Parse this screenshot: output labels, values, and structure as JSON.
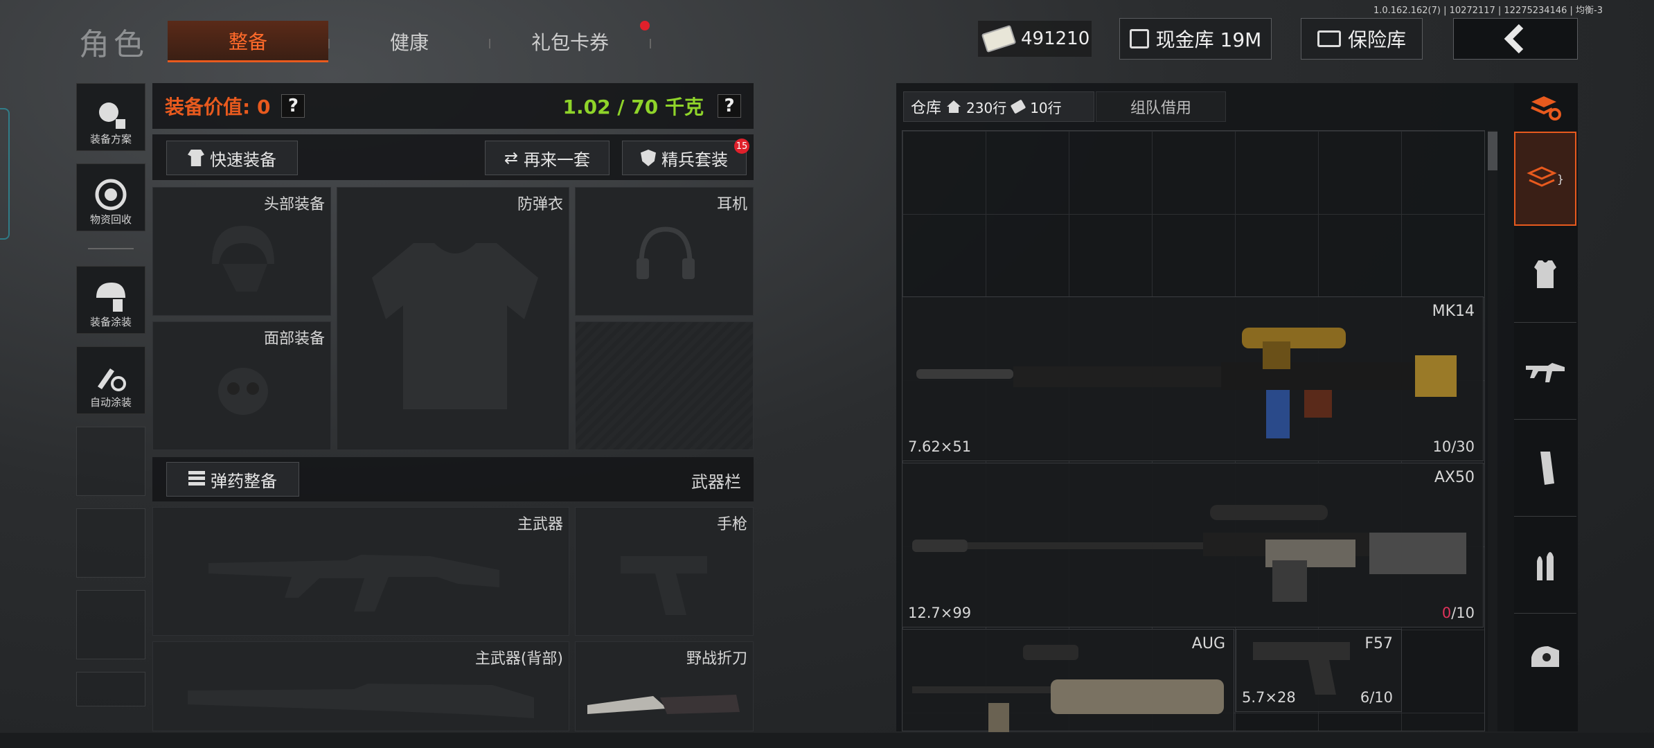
{
  "version_info": "1.0.162.162(7) | 10272117 | 12275234146 | 均衡-3",
  "header": {
    "title": "角色",
    "tabs": [
      {
        "label": "整备",
        "active": true
      },
      {
        "label": "健康",
        "active": false
      },
      {
        "label": "礼包卡券",
        "active": false,
        "has_dot": true
      }
    ],
    "currency": "491210",
    "cash_vault": "现金库 19M",
    "safe_box": "保险库"
  },
  "left_sidebar": [
    {
      "label": "装备方案",
      "icon": "soldier-plan-icon"
    },
    {
      "label": "物资回收",
      "icon": "recycle-icon"
    },
    {
      "label": "装备涂装",
      "icon": "paint-helmet-icon"
    },
    {
      "label": "自动涂装",
      "icon": "auto-paint-icon"
    }
  ],
  "loadout": {
    "value_label": "装备价值: 0",
    "weight": "1.02 / 70 千克",
    "quick_equip": "快速装备",
    "redo": "再来一套",
    "elite_set": "精兵套装",
    "elite_badge": "15",
    "slots": {
      "head": "头部装备",
      "armor": "防弹衣",
      "headset": "耳机",
      "face": "面部装备"
    },
    "ammo_equip": "弹药整备",
    "weapon_bar": "武器栏",
    "weapons": {
      "primary": "主武器",
      "pistol": "手枪",
      "primary_back": "主武器(背部)",
      "knife": "野战折刀"
    }
  },
  "warehouse": {
    "tab_label": "仓库",
    "rows": "230行",
    "rows2": "10行",
    "team_borrow": "组队借用",
    "items": [
      {
        "name": "MK14",
        "caliber": "7.62×51",
        "ammo_cur": "10",
        "ammo_max": "/30"
      },
      {
        "name": "AX50",
        "caliber": "12.7×99",
        "ammo_cur": "0",
        "ammo_max": "/10"
      },
      {
        "name": "AUG",
        "caliber": "",
        "ammo_cur": "",
        "ammo_max": ""
      },
      {
        "name": "F57",
        "caliber": "5.7×28",
        "ammo_cur": "6",
        "ammo_max": "/10"
      }
    ]
  },
  "colors": {
    "accent_orange": "#e85a1e",
    "weight_green": "#8fd42a",
    "ammo_zero_red": "#e0335b"
  }
}
